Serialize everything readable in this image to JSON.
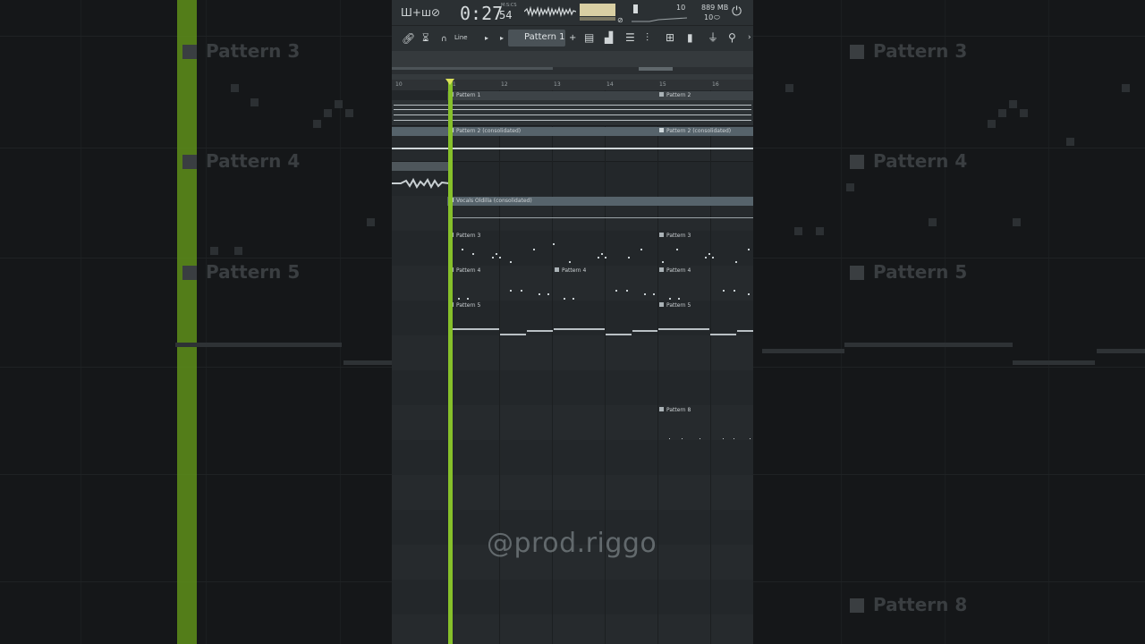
{
  "toolbar": {
    "time_main": "0:27",
    "time_sub": "54",
    "time_tag": "M:S:CS",
    "cpu_value": "10",
    "ram_value": "889 MB",
    "poly_value": "10",
    "snap_label": "Line",
    "pattern_label": "Pattern 1"
  },
  "ruler": [
    "10",
    "11",
    "12",
    "13",
    "14",
    "15",
    "16"
  ],
  "clips": {
    "pattern1": "Pattern 1",
    "pattern2": "Pattern 2",
    "pattern2c": "Pattern 2 (consolidated)",
    "vocals": "Vocals Oldilla (consolidated)",
    "pattern3": "Pattern 3",
    "pattern4": "Pattern 4",
    "pattern5": "Pattern 5",
    "pattern8": "Pattern 8"
  },
  "background": {
    "labels": [
      "Pattern 3",
      "Pattern 4",
      "Pattern 5",
      "Pattern 8"
    ]
  },
  "watermark": "@prod.riggo",
  "colors": {
    "playhead": "#86c02a",
    "meter": "#d9cfa3",
    "clip_header": "#56636b"
  }
}
